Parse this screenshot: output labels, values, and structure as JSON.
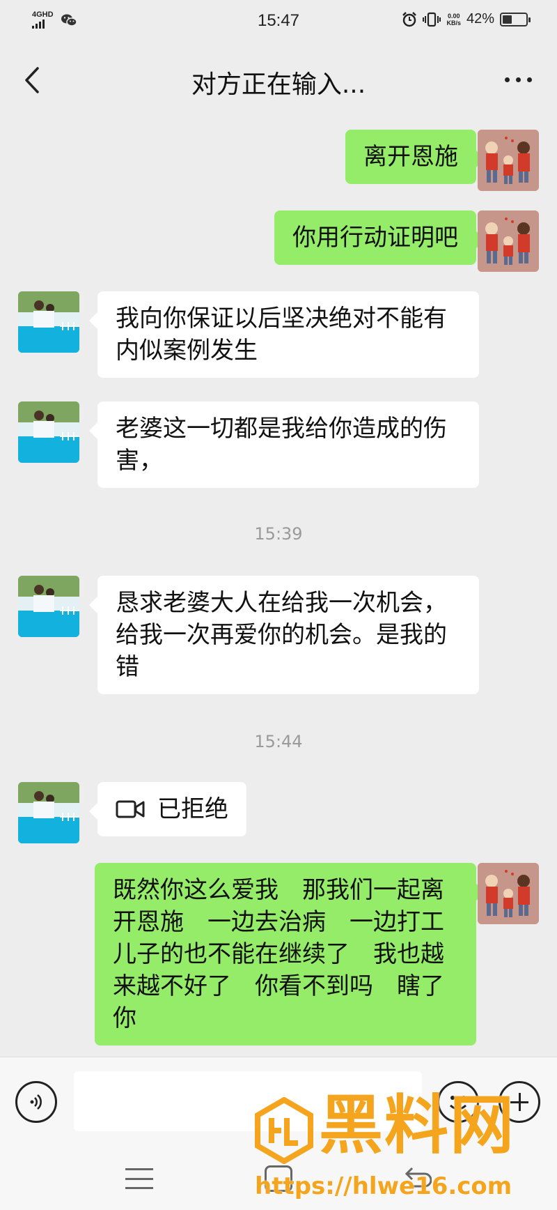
{
  "status_bar": {
    "network": "4GHD",
    "time": "15:47",
    "net_speed": "0.00",
    "net_speed_unit": "KB/s",
    "battery_pct": "42%",
    "battery_level": 0.42
  },
  "header": {
    "title": "对方正在输入..."
  },
  "messages": [
    {
      "side": "me",
      "text": "离开恩施"
    },
    {
      "side": "me",
      "text": "你用行动证明吧"
    },
    {
      "side": "them",
      "text": "我向你保证以后坚决绝对不能有内似案例发生"
    },
    {
      "side": "them",
      "text": "老婆这一切都是我给你造成的伤害，"
    },
    {
      "type": "time",
      "text": "15:39"
    },
    {
      "side": "them",
      "text": "恳求老婆大人在给我一次机会，给我一次再爱你的机会。是我的错"
    },
    {
      "type": "time",
      "text": "15:44"
    },
    {
      "side": "them",
      "text": "已拒绝",
      "icon": "video-call-icon"
    },
    {
      "side": "me",
      "text": "既然你这么爱我　那我们一起离开恩施　一边去治病　一边打工　儿子的也不能在继续了　我也越来越不好了　你看不到吗　瞎了你"
    }
  ],
  "input_bar": {
    "placeholder": ""
  },
  "watermark": {
    "title": "黑料网",
    "url": "https://hlwe16.com"
  }
}
